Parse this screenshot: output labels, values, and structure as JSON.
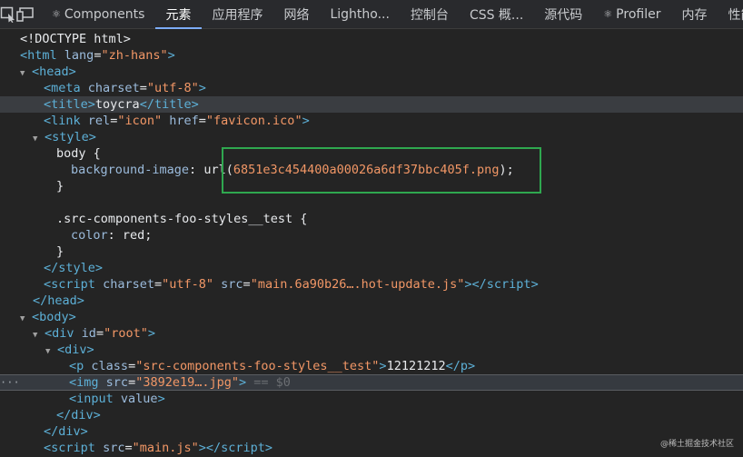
{
  "tabs": [
    {
      "icon": "react-icon",
      "glyph": "⚛",
      "label": "Components",
      "active": false
    },
    {
      "icon": "",
      "glyph": "",
      "label": "元素",
      "active": true
    },
    {
      "icon": "",
      "glyph": "",
      "label": "应用程序",
      "active": false
    },
    {
      "icon": "",
      "glyph": "",
      "label": "网络",
      "active": false
    },
    {
      "icon": "",
      "glyph": "",
      "label": "Lightho...",
      "active": false
    },
    {
      "icon": "",
      "glyph": "",
      "label": "控制台",
      "active": false
    },
    {
      "icon": "",
      "glyph": "",
      "label": "CSS 概...",
      "active": false
    },
    {
      "icon": "",
      "glyph": "",
      "label": "源代码",
      "active": false
    },
    {
      "icon": "react-icon",
      "glyph": "⚛",
      "label": "Profiler",
      "active": false
    },
    {
      "icon": "",
      "glyph": "",
      "label": "内存",
      "active": false
    },
    {
      "icon": "",
      "glyph": "",
      "label": "性能",
      "active": false
    }
  ],
  "code": {
    "doctype": "<!DOCTYPE html>",
    "html_tag": "html",
    "html_attr": "lang",
    "html_val": "\"zh-hans\"",
    "head": "head",
    "meta_tag": "meta",
    "meta_attr": "charset",
    "meta_val": "\"utf-8\"",
    "title_tag": "title",
    "title_text": "toycra",
    "link_tag": "link",
    "link_attr1": "rel",
    "link_val1": "\"icon\"",
    "link_attr2": "href",
    "link_val2": "\"favicon.ico\"",
    "style_tag": "style",
    "css_body": "body {",
    "css_bg_prop": "background-image",
    "css_bg_url_a": "ur",
    "css_bg_url_b": "l(",
    "css_bg_file": "6851e3c454400a00026a6df37bbc405f.png",
    "css_bg_end": ");",
    "css_close1": "}",
    "css_sel2": ".src-components-foo-styles__test {",
    "css_color_prop": "color",
    "css_color_val": "red;",
    "css_close2": "}",
    "script_tag": "script",
    "script_attr1": "charset",
    "script_val1": "\"utf-8\"",
    "script_attr2": "src",
    "script_val2": "\"main.6a90b26….hot-update.js\"",
    "body_tag": "body",
    "div_tag": "div",
    "div_attr": "id",
    "div_val": "\"root\"",
    "p_tag": "p",
    "p_attr": "class",
    "p_val": "\"src-components-foo-styles__test\"",
    "p_text": "12121212",
    "img_tag": "img",
    "img_attr": "src",
    "img_val": "\"3892e19….jpg\"",
    "img_after": "== $0",
    "input_tag": "input",
    "input_attr": "value",
    "script2_attr": "src",
    "script2_val": "\"main.js\"",
    "dots": "···"
  },
  "watermark": "@稀土掘金技术社区"
}
